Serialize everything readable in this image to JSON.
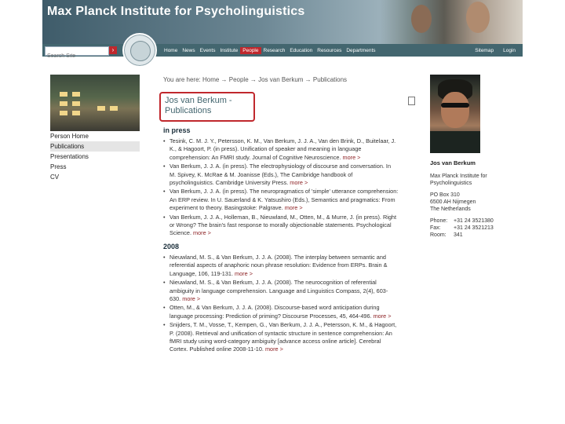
{
  "header": {
    "title": "Max Planck Institute for Psycholinguistics"
  },
  "search": {
    "placeholder": "Search Site",
    "go_icon": "arrow-right-icon"
  },
  "nav": {
    "items": [
      {
        "label": "Home",
        "active": false
      },
      {
        "label": "News",
        "active": false
      },
      {
        "label": "Events",
        "active": false
      },
      {
        "label": "Institute",
        "active": false
      },
      {
        "label": "People",
        "active": true
      },
      {
        "label": "Research",
        "active": false
      },
      {
        "label": "Education",
        "active": false
      },
      {
        "label": "Resources",
        "active": false
      },
      {
        "label": "Departments",
        "active": false
      }
    ],
    "right": [
      {
        "label": "Sitemap"
      },
      {
        "label": "Login"
      }
    ],
    "colors": {
      "bar": "#43666f",
      "active": "#c0282d"
    }
  },
  "breadcrumb": "You are here: Home → People → Jos van Berkum → Publications",
  "page_title": {
    "line1": "Jos van Berkum -",
    "line2": "Publications"
  },
  "side_menu": [
    {
      "label": "Person Home",
      "current": false
    },
    {
      "label": "Publications",
      "current": true
    },
    {
      "label": "Presentations",
      "current": false
    },
    {
      "label": "Press",
      "current": false
    },
    {
      "label": "CV",
      "current": false
    }
  ],
  "sections": [
    {
      "heading": "in press",
      "pubs": [
        {
          "text": "Tesink, C. M. J. Y., Petersson, K. M., Van Berkum, J. J. A., Van den Brink, D., Buitelaar, J. K., & Hagoort, P. (in press). Unification of speaker and meaning in language comprehension: An FMRI study. Journal of Cognitive Neuroscience.",
          "more": "more >"
        },
        {
          "text": "Van Berkum, J. J. A. (in press). The electrophysiology of discourse and conversation. In M. Spivey, K. McRae & M. Joanisse (Eds.), The Cambridge handbook of psycholinguistics. Cambridge University Press.",
          "more": "more >"
        },
        {
          "text": "Van Berkum, J. J. A. (in press). The neuropragmatics of 'simple' utterance comprehension: An ERP review. In U. Sauerland & K. Yatsushiro (Eds.), Semantics and pragmatics: From experiment to theory. Basingstoke: Palgrave.",
          "more": "more >"
        },
        {
          "text": "Van Berkum, J. J. A., Holleman, B., Nieuwland, M., Otten, M., & Murre, J. (in press). Right or Wrong? The brain's fast response to morally objectionable statements. Psychological Science.",
          "more": "more >"
        }
      ]
    },
    {
      "heading": "2008",
      "pubs": [
        {
          "text": "Nieuwland, M. S., & Van Berkum, J. J. A. (2008). The interplay between semantic and referential aspects of anaphoric noun phrase resolution: Evidence from ERPs. Brain & Language, 106, 119-131.",
          "more": "more >"
        },
        {
          "text": "Nieuwland, M. S., & Van Berkum, J. J. A. (2008). The neurocognition of referential ambiguity in language comprehension. Language and Linguistics Compass, 2(4), 603-630.",
          "more": "more >"
        },
        {
          "text": "Otten, M., & Van Berkum, J. J. A. (2008). Discourse-based word anticipation during language processing: Prediction of priming? Discourse Processes, 45, 464-496.",
          "more": "more >"
        },
        {
          "text": "Snijders, T. M., Vosse, T., Kempen, G., Van Berkum, J. J. A., Petersson, K. M., & Hagoort, P. (2008). Retrieval and unification of syntactic structure in sentence comprehension: An fMRI study using word-category ambiguity [advance access online article]. Cerebral Cortex. Published online 2008-11-10.",
          "more": "more >"
        }
      ]
    }
  ],
  "profile": {
    "name": "Jos van Berkum",
    "affiliation": [
      "Max Planck Institute for",
      "Psycholinguistics"
    ],
    "address": [
      "PO Box 310",
      "6500 AH Nijmegen",
      "The Netherlands"
    ],
    "contact": [
      {
        "label": "Phone:",
        "value": "+31 24 3521380"
      },
      {
        "label": "Fax:",
        "value": "+31 24 3521213"
      },
      {
        "label": "Room:",
        "value": "341"
      }
    ]
  }
}
